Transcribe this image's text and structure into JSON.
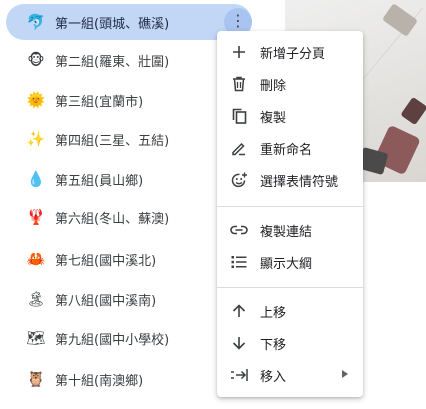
{
  "sidebar": {
    "items": [
      {
        "emoji": "🐬",
        "label": "第一組(頭城、礁溪)",
        "selected": true
      },
      {
        "emoji": "🐵",
        "label": "第二組(羅東、壯圍)"
      },
      {
        "emoji": "🌞",
        "label": "第三組(宜蘭市)"
      },
      {
        "emoji": "✨",
        "label": "第四組(三星、五結)"
      },
      {
        "emoji": "💧",
        "label": "第五組(員山鄉)"
      },
      {
        "emoji": "🦞",
        "label": "第六組(冬山、蘇澳)"
      },
      {
        "emoji": "🦀",
        "label": "第七組(國中溪北)"
      },
      {
        "emoji": "🏝",
        "label": "第八組(國中溪南)"
      },
      {
        "emoji": "🗺",
        "label": "第九組(國中小學校)"
      },
      {
        "emoji": "🦉",
        "label": "第十組(南澳鄉)"
      }
    ],
    "more_icon": "⋮"
  },
  "menu": {
    "groups": [
      [
        {
          "icon": "plus-icon",
          "label": "新增子分頁"
        },
        {
          "icon": "trash-icon",
          "label": "刪除"
        },
        {
          "icon": "copy-icon",
          "label": "複製"
        },
        {
          "icon": "rename-icon",
          "label": "重新命名"
        },
        {
          "icon": "emoji-add-icon",
          "label": "選擇表情符號"
        }
      ],
      [
        {
          "icon": "link-icon",
          "label": "複製連結"
        },
        {
          "icon": "list-icon",
          "label": "顯示大綱"
        }
      ],
      [
        {
          "icon": "arrow-up-icon",
          "label": "上移"
        },
        {
          "icon": "arrow-down-icon",
          "label": "下移"
        },
        {
          "icon": "move-icon",
          "label": "移入",
          "submenu": true
        }
      ]
    ]
  }
}
